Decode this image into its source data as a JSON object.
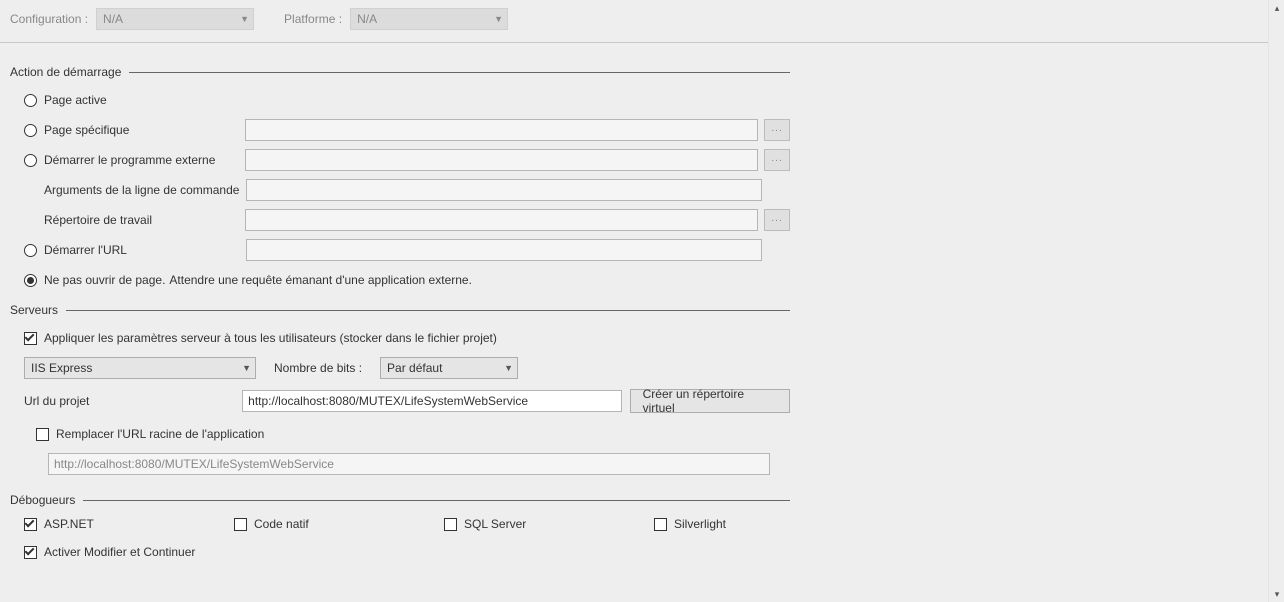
{
  "topbar": {
    "configuration_label": "Configuration :",
    "configuration_value": "N/A",
    "platform_label": "Platforme :",
    "platform_value": "N/A"
  },
  "startAction": {
    "title": "Action de démarrage",
    "activePage": "Page active",
    "specificPage": "Page spécifique",
    "specificPageValue": "",
    "externalProgram": "Démarrer le programme externe",
    "externalProgramValue": "",
    "cmdArgsLabel": "Arguments de la ligne de commande",
    "cmdArgsValue": "",
    "workDirLabel": "Répertoire de travail",
    "workDirValue": "",
    "startUrl": "Démarrer l'URL",
    "startUrlValue": "",
    "noPageOpen": "Ne pas ouvrir de page.",
    "waitExternal": "Attendre une requête émanant d'une application externe.",
    "browse": "..."
  },
  "servers": {
    "title": "Serveurs",
    "applyAll": "Appliquer les paramètres serveur à tous les utilisateurs (stocker dans le fichier projet)",
    "serverType": "IIS Express",
    "bitsLabel": "Nombre de bits :",
    "bitsValue": "Par défaut",
    "projectUrlLabel": "Url du projet",
    "projectUrlValue": "http://localhost:8080/MUTEX/LifeSystemWebService",
    "createVDir": "Créer un répertoire virtuel",
    "overrideRoot": "Remplacer l'URL racine de l'application",
    "overrideRootValue": "http://localhost:8080/MUTEX/LifeSystemWebService"
  },
  "debuggers": {
    "title": "Débogueurs",
    "aspnet": "ASP.NET",
    "native": "Code natif",
    "sql": "SQL Server",
    "silverlight": "Silverlight",
    "editContinue": "Activer Modifier et Continuer"
  }
}
